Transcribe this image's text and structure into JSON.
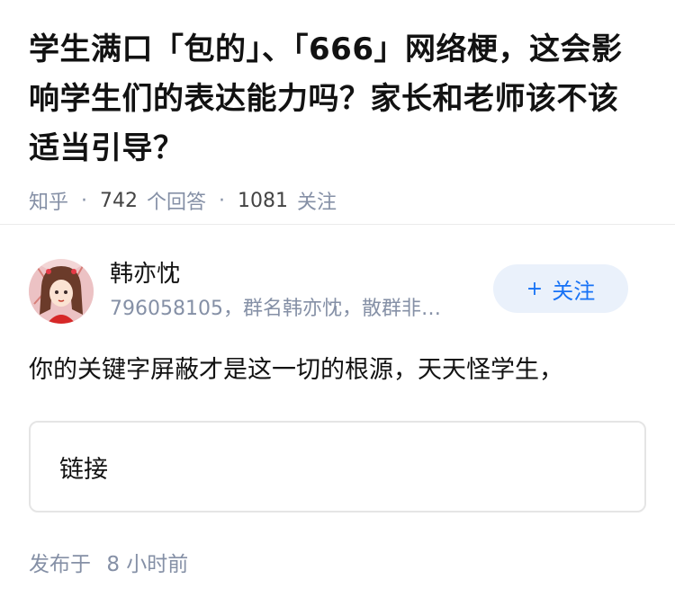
{
  "question": {
    "title": "学生满口「包的」、「666」网络梗，这会影响学生们的表达能力吗？家长和老师该不该适当引导？",
    "source": "知乎",
    "separator": "·",
    "answer_count": "742",
    "answer_unit": "个回答",
    "follower_count": "1081",
    "follower_unit": "关注"
  },
  "answer": {
    "author_name": "韩亦忱",
    "author_bio": "796058105，群名韩亦忱，散群非…",
    "follow_label": "关注",
    "follow_icon": "plus-icon",
    "text": "你的关键字屏蔽才是这一切的根源，天天怪学生，",
    "link_label": "链接",
    "publish_prefix": "发布于",
    "publish_time": "8 小时前"
  },
  "colors": {
    "accent": "#1772f6",
    "follow_bg": "#eaf1fb",
    "muted": "#8590a6"
  }
}
